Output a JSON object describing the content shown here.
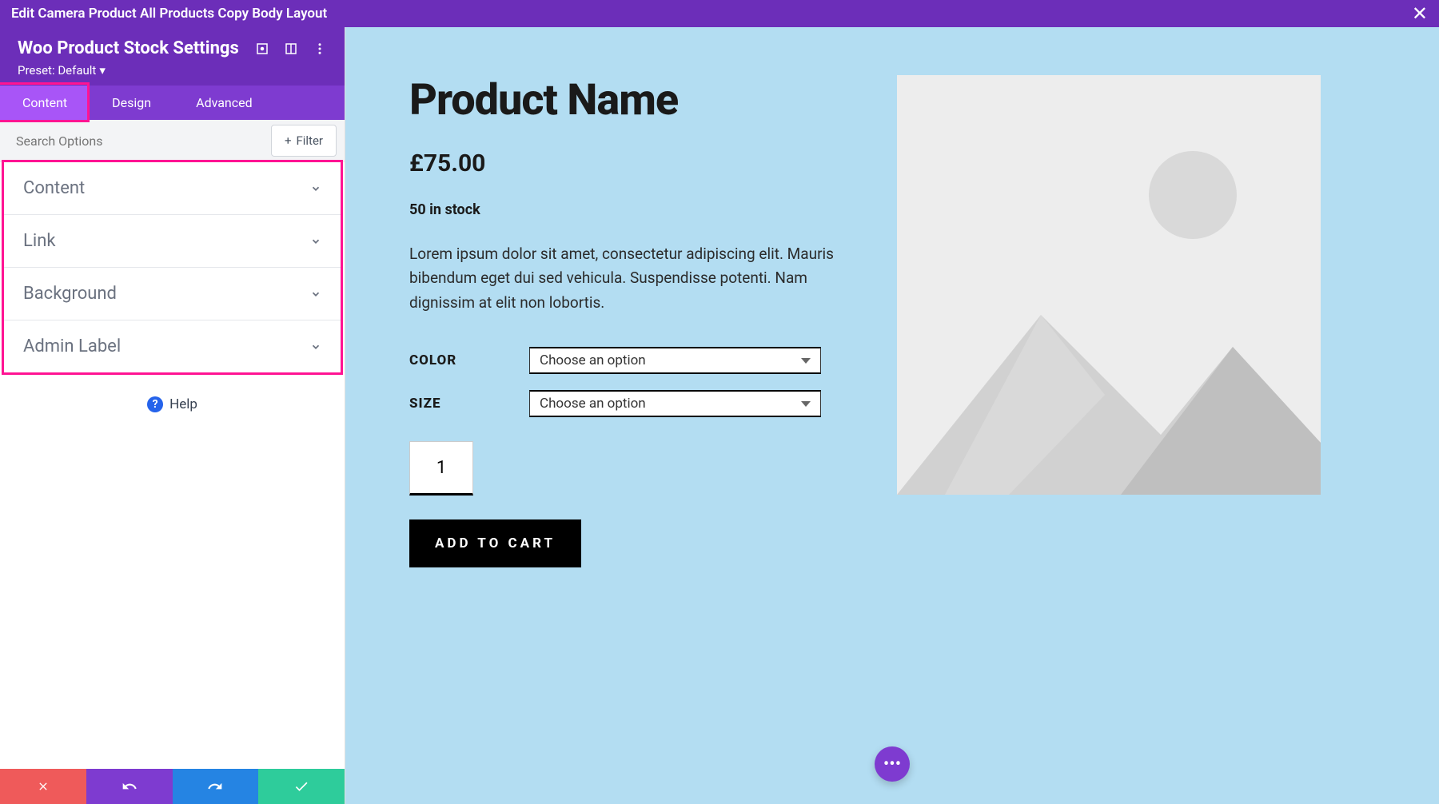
{
  "topbar": {
    "title": "Edit Camera Product All Products Copy Body Layout"
  },
  "sidebar": {
    "title": "Woo Product Stock Settings",
    "preset_label": "Preset: Default",
    "tabs": [
      "Content",
      "Design",
      "Advanced"
    ],
    "search_placeholder": "Search Options",
    "filter_label": "Filter",
    "sections": [
      "Content",
      "Link",
      "Background",
      "Admin Label"
    ],
    "help_label": "Help"
  },
  "product": {
    "title": "Product Name",
    "price": "£75.00",
    "stock": "50 in stock",
    "description": "Lorem ipsum dolor sit amet, consectetur adipiscing elit. Mauris bibendum eget dui sed vehicula. Suspendisse potenti. Nam dignissim at elit non lobortis.",
    "color_label": "COLOR",
    "size_label": "SIZE",
    "option_placeholder": "Choose an option",
    "qty": "1",
    "add_to_cart": "ADD TO CART"
  }
}
